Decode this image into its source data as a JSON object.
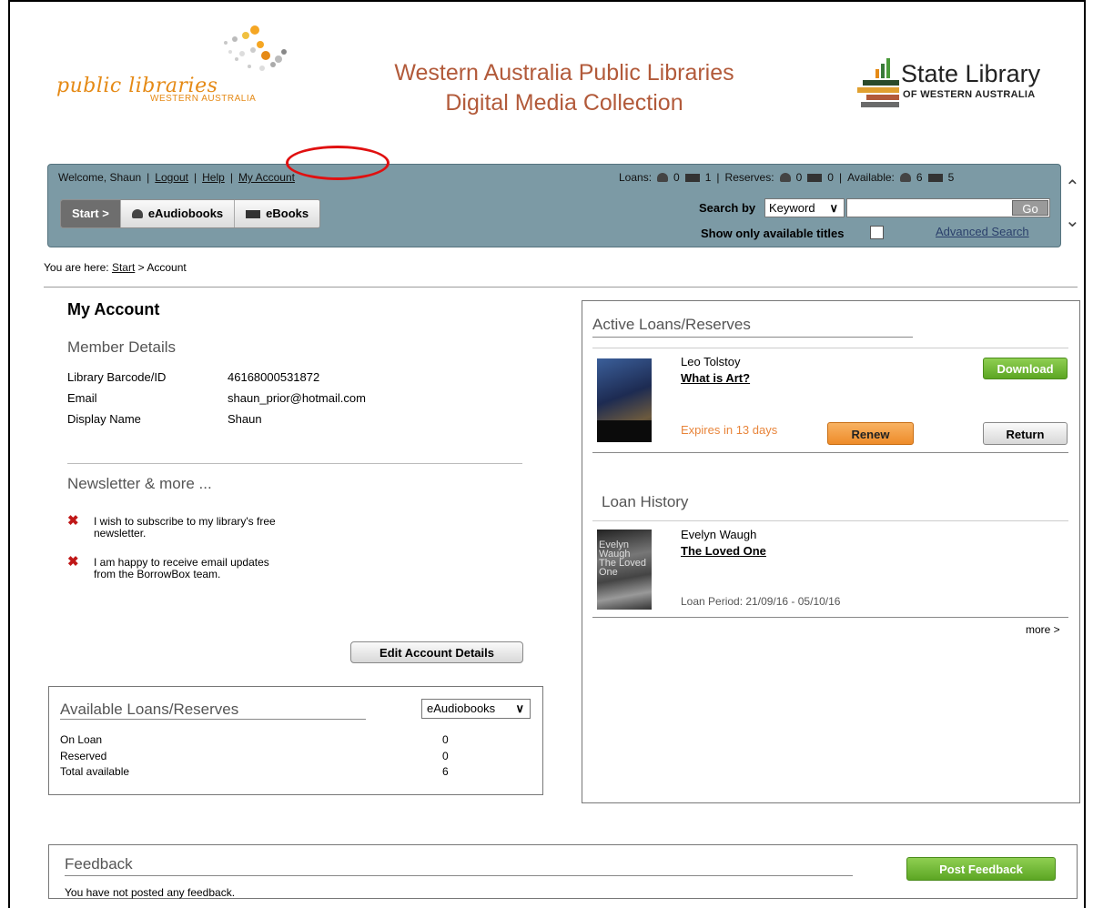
{
  "header": {
    "pl_logo_text": "public libraries",
    "pl_logo_sub": "WESTERN AUSTRALIA",
    "site_title_line1": "Western Australia Public Libraries",
    "site_title_line2": "Digital Media Collection",
    "sl_logo_text": "State Library",
    "sl_logo_sub": "OF WESTERN AUSTRALIA"
  },
  "nav": {
    "welcome": "Welcome, Shaun",
    "logout": "Logout",
    "help": "Help",
    "my_account": "My Account",
    "loans_label": "Loans:",
    "loans_audio": "0",
    "loans_ebook": "1",
    "reserves_label": "Reserves:",
    "reserves_audio": "0",
    "reserves_ebook": "0",
    "available_label": "Available:",
    "available_audio": "6",
    "available_ebook": "5",
    "tabs": [
      {
        "label": "Start >"
      },
      {
        "label": "eAudiobooks"
      },
      {
        "label": "eBooks"
      }
    ],
    "search_by_label": "Search by",
    "search_by_value": "Keyword",
    "search_value": "",
    "go_label": "Go",
    "show_available_label": "Show only available titles",
    "advanced_search": "Advanced Search"
  },
  "breadcrumb": {
    "prefix": "You are here:",
    "start": "Start",
    "current": "> Account"
  },
  "account": {
    "title": "My Account",
    "member_details_heading": "Member Details",
    "details": [
      {
        "label": "Library Barcode/ID",
        "value": "46168000531872"
      },
      {
        "label": "Email",
        "value": "shaun_prior@hotmail.com"
      },
      {
        "label": "Display Name",
        "value": "Shaun"
      }
    ],
    "newsletter_heading": "Newsletter & more ...",
    "newsletter_items": [
      {
        "line1": "I wish to subscribe to my library's free",
        "line2": "newsletter."
      },
      {
        "line1": "I am happy to receive email updates",
        "line2": "from the BorrowBox team."
      }
    ],
    "edit_button": "Edit Account Details"
  },
  "available_box": {
    "heading": "Available Loans/Reserves",
    "select_value": "eAudiobooks",
    "rows": [
      {
        "label": "On Loan",
        "value": "0"
      },
      {
        "label": "Reserved",
        "value": "0"
      },
      {
        "label": "Total available",
        "value": "6"
      }
    ]
  },
  "active_loans": {
    "heading": "Active Loans/Reserves",
    "item": {
      "author": "Leo Tolstoy",
      "title": "What is Art?",
      "expires": "Expires in 13 days",
      "download": "Download",
      "renew": "Renew",
      "return": "Return"
    }
  },
  "loan_history": {
    "heading": "Loan History",
    "item": {
      "author": "Evelyn Waugh",
      "title": "The Loved One",
      "cover_text": "Evelyn Waugh The Loved One",
      "period": "Loan Period: 21/09/16 - 05/10/16"
    },
    "more": "more >"
  },
  "feedback": {
    "heading": "Feedback",
    "text": "You have not posted any feedback.",
    "button": "Post Feedback"
  },
  "colors": {
    "navbar": "#7c9aa5",
    "title_brown": "#b25a3a",
    "orange": "#e58a16",
    "green_button": "#5ca623",
    "renew_orange": "#ee8c2a",
    "annotation_red": "#e01010"
  }
}
